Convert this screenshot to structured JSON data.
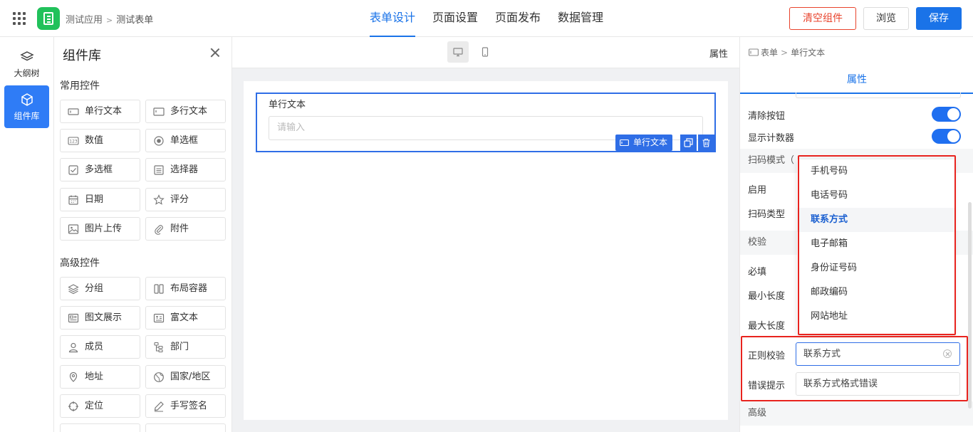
{
  "header": {
    "breadcrumb": [
      "测试应用",
      "测试表单"
    ],
    "tabs": [
      {
        "label": "表单设计",
        "active": true
      },
      {
        "label": "页面设置",
        "active": false
      },
      {
        "label": "页面发布",
        "active": false
      },
      {
        "label": "数据管理",
        "active": false
      }
    ],
    "clear_label": "清空组件",
    "preview_label": "浏览",
    "save_label": "保存",
    "accent_color": "#1a73e8",
    "danger_color": "#e8432c"
  },
  "rail": {
    "items": [
      {
        "label": "大纲树",
        "icon": "layers-icon",
        "active": false
      },
      {
        "label": "组件库",
        "icon": "cube-icon",
        "active": true
      }
    ]
  },
  "library": {
    "title": "组件库",
    "common_title": "常用控件",
    "common": [
      {
        "label": "单行文本",
        "icon": "single-line-icon"
      },
      {
        "label": "多行文本",
        "icon": "multi-line-icon"
      },
      {
        "label": "数值",
        "icon": "number-icon"
      },
      {
        "label": "单选框",
        "icon": "radio-icon"
      },
      {
        "label": "多选框",
        "icon": "checkbox-icon"
      },
      {
        "label": "选择器",
        "icon": "select-icon"
      },
      {
        "label": "日期",
        "icon": "calendar-icon"
      },
      {
        "label": "评分",
        "icon": "star-icon"
      },
      {
        "label": "图片上传",
        "icon": "image-icon"
      },
      {
        "label": "附件",
        "icon": "paperclip-icon"
      }
    ],
    "advanced_title": "高级控件",
    "advanced": [
      {
        "label": "分组",
        "icon": "group-icon"
      },
      {
        "label": "布局容器",
        "icon": "layout-icon"
      },
      {
        "label": "图文展示",
        "icon": "media-icon"
      },
      {
        "label": "富文本",
        "icon": "richtext-icon"
      },
      {
        "label": "成员",
        "icon": "user-icon"
      },
      {
        "label": "部门",
        "icon": "department-icon"
      },
      {
        "label": "地址",
        "icon": "location-icon"
      },
      {
        "label": "国家/地区",
        "icon": "globe-icon"
      },
      {
        "label": "定位",
        "icon": "target-icon"
      },
      {
        "label": "手写签名",
        "icon": "pen-icon"
      }
    ]
  },
  "canvas": {
    "property_label": "属性",
    "field": {
      "label": "单行文本",
      "placeholder": "请输入",
      "tag": "单行文本"
    }
  },
  "panel": {
    "breadcrumb": [
      "表单",
      "单行文本"
    ],
    "tab": "属性",
    "clear_button_label": "清除按钮",
    "clear_button_on": true,
    "counter_label": "显示计数器",
    "counter_on": true,
    "scan_section": "扫码模式（",
    "enable_label": "启用",
    "scan_type_label": "扫码类型",
    "validate_section": "校验",
    "required_label": "必填",
    "min_length_label": "最小长度",
    "max_length_label": "最大长度",
    "regex_label": "正则校验",
    "regex_value": "联系方式",
    "error_label": "错误提示",
    "error_value": "联系方式格式错误",
    "advanced_section": "高级"
  },
  "dropdown": {
    "options": [
      "手机号码",
      "电话号码",
      "联系方式",
      "电子邮箱",
      "身份证号码",
      "邮政编码",
      "网站地址"
    ],
    "selected": "联系方式"
  }
}
